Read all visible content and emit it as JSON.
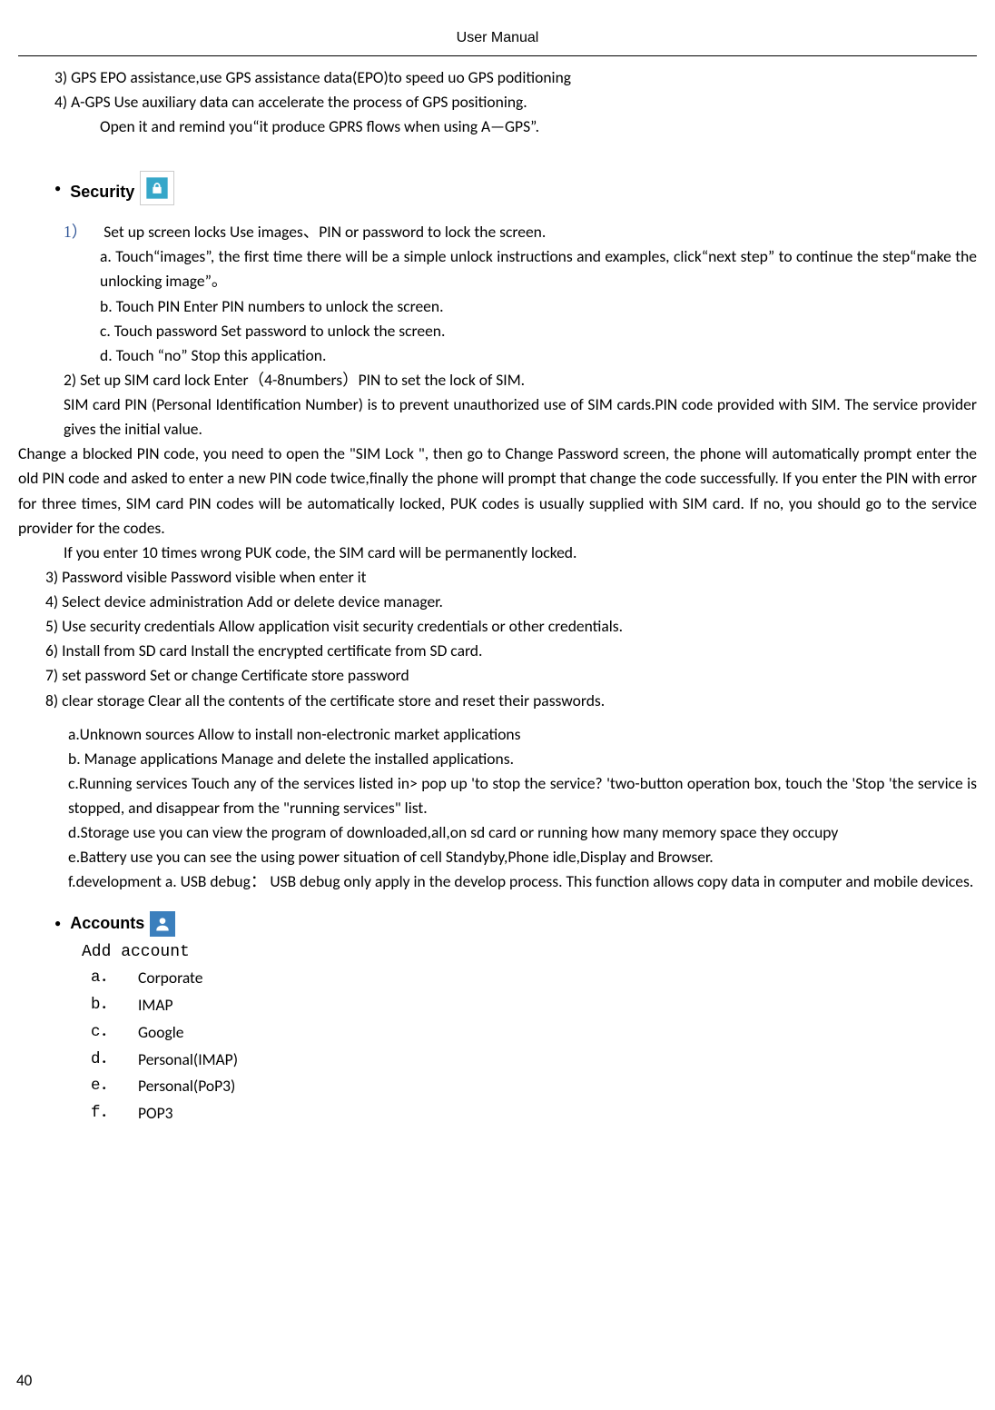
{
  "header": "User    Manual",
  "gps": {
    "line3": "3) GPS EPO assistance,use GPS assistance data(EPO)to speed uo GPS poditioning",
    "line4": "4) A-GPS      Use auxiliary data can accelerate the process of GPS positioning.",
    "line4b": "Open it and remind you“it produce GPRS flows when using A—GPS”."
  },
  "security": {
    "heading": "Security",
    "item1_num": "1）",
    "item1": "Set up screen locks      Use images、PIN or password to lock the screen.",
    "item1a": "a. Touch“images”,    the first time there will be a simple unlock instructions and examples, click“next step” to continue the step“make the unlocking image”。",
    "item1b": "b. Touch PIN Enter PIN numbers to unlock the screen.",
    "item1c": "c. Touch password      Set password to unlock the screen.",
    "item1d": "d. Touch “no”     Stop this application.",
    "item2": "2)    Set up SIM card lock      Enter（4-8numbers）PIN to set the lock of SIM.",
    "sim_para": "SIM card PIN (Personal Identification Number) is to prevent unauthorized use of SIM cards.PIN code provided with SIM. The service provider gives the initial value.",
    "change_para": "Change a blocked PIN code, you need to open the \"SIM Lock \", then go to Change Password screen, the phone will automatically prompt enter the old PIN code and asked to enter a new PIN code twice,finally the phone will prompt that change the code successfully. If you enter the PIN with error for three times, SIM card PIN codes will be automatically locked, PUK codes is usually supplied with SIM card. If no, you should go to the service provider for the codes.",
    "puk_line": "If you enter 10 times wrong PUK code, the SIM card will be permanently locked.",
    "item3": "3)    Password visible        Password visible when enter it",
    "item4": "4)    Select device administration      Add or delete device manager.",
    "item5": "5)    Use security credentials        Allow application visit security credentials or other credentials.",
    "item6": "6)    Install from SD card      Install the encrypted certificate from SD card.",
    "item7": "7)    set password        Set or change Certificate store password",
    "item8": "8)    clear storage        Clear all the contents of the certificate store and reset their passwords.",
    "sub_a": "a.Unknown sources              Allow to install non-electronic market applications",
    "sub_b": "b. Manage applications          Manage and delete the installed applications.",
    "sub_c": "c.Running services      Touch any of the services listed in> pop up 'to stop the service? 'two-button operation box, touch the 'Stop 'the service is stopped, and disappear from the \"running services\" list.",
    "sub_d": "d.Storage use          you can view the program of downloaded,all,on sd card or running    how many memory space they occupy",
    "sub_e": "e.Battery use          you can see the using power situation of cell Standyby,Phone idle,Display and Browser.",
    "sub_f": "f.development          a. USB debug： USB debug only apply in the develop process. This function allows copy data in computer and mobile devices."
  },
  "accounts": {
    "heading": "Accounts",
    "add": "Add account",
    "items": [
      {
        "letter": "a．",
        "text": "Corporate"
      },
      {
        "letter": "b．",
        "text": "IMAP"
      },
      {
        "letter": "c．",
        "text": "Google"
      },
      {
        "letter": "d．",
        "text": "Personal(IMAP)"
      },
      {
        "letter": "e．",
        "text": "Personal(PoP3)"
      },
      {
        "letter": "f．",
        "text": "POP3"
      }
    ]
  },
  "pageno": "40"
}
